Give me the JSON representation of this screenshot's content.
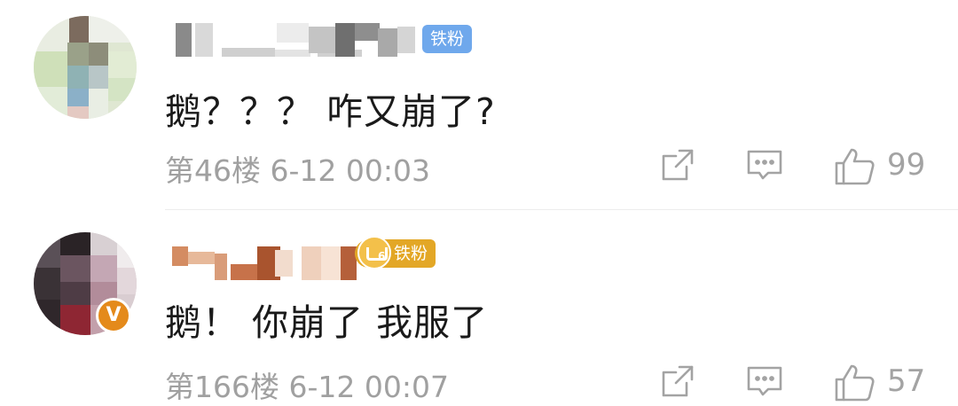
{
  "comments": [
    {
      "badge": "铁粉",
      "text": "鹅？？？ 咋又崩了?",
      "floor": "第46楼",
      "datetime": "6-12 00:03",
      "likes": "99",
      "badge_color": "#6fa8ec"
    },
    {
      "badge": "铁粉",
      "badge_level": "6",
      "verified_mark": "V",
      "text": "鹅！ 你崩了 我服了",
      "floor": "第166楼",
      "datetime": "6-12 00:07",
      "likes": "57",
      "badge_color": "#e3a726",
      "verified_color": "#e48a1b"
    }
  ],
  "icons": {
    "share": "share-icon",
    "reply": "comment-icon",
    "like": "thumbs-up-icon"
  },
  "colors": {
    "text": "#1a1a1a",
    "meta": "#a0a0a0",
    "divider": "#ececec"
  }
}
